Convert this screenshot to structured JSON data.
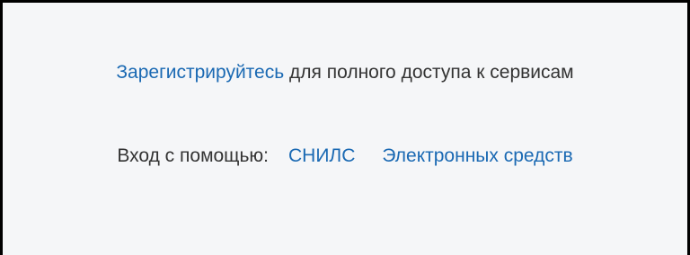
{
  "register": {
    "link_label": "Зарегистрируйтесь",
    "suffix_text": " для полного доступа к сервисам"
  },
  "login": {
    "label": "Вход с помощью:",
    "snils_label": "СНИЛС",
    "electronic_label": "Электронных средств"
  },
  "colors": {
    "link": "#1a69b3",
    "text": "#333333",
    "background": "#f5f6f8",
    "border": "#000000"
  }
}
